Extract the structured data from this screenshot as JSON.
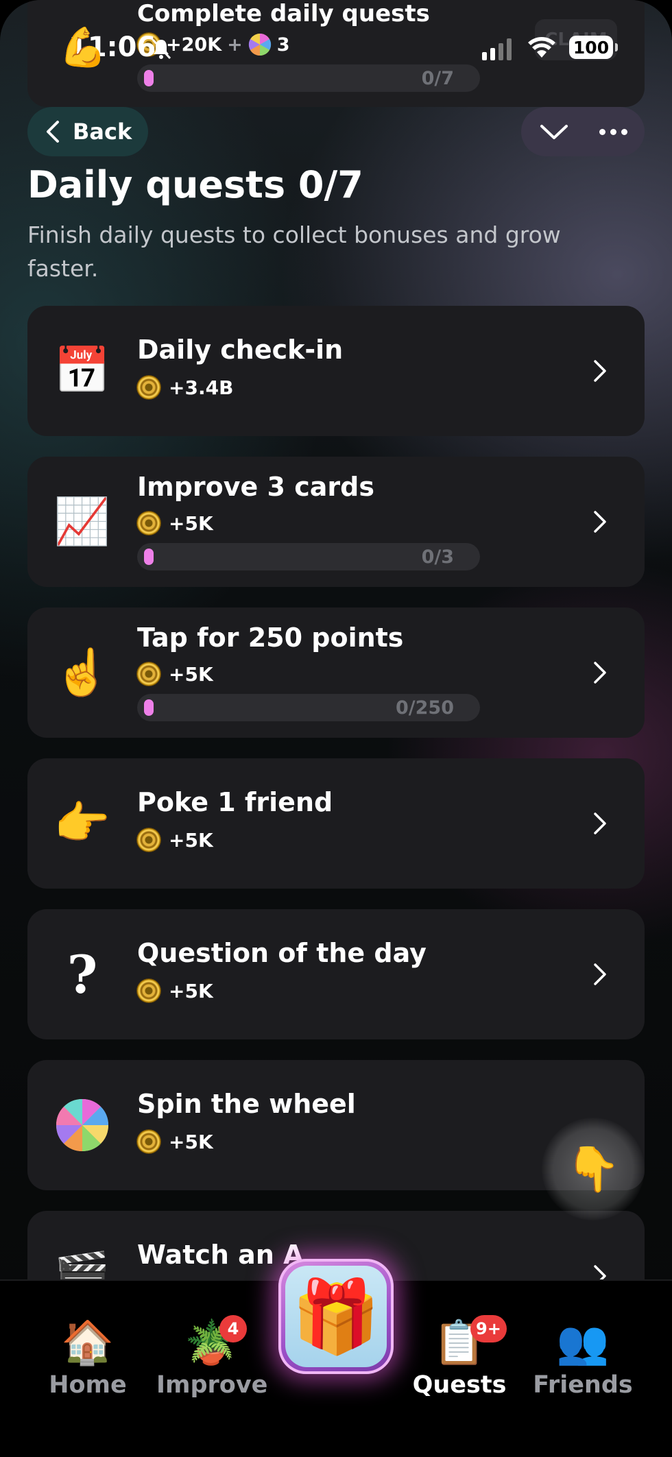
{
  "top_card": {
    "title": "Complete daily quests",
    "reward_coins": "+20K",
    "reward_plus": "+",
    "reward_spins": "3",
    "progress_text": "0/7",
    "progress": 0,
    "claim_label": "CLAIM"
  },
  "status_bar": {
    "time": "11:06",
    "battery": "100"
  },
  "nav": {
    "back_label": "Back"
  },
  "header": {
    "title": "Daily quests 0/7",
    "subtitle": "Finish daily quests to collect bonuses and grow faster."
  },
  "quests": [
    {
      "title": "Daily check-in",
      "reward": "+3.4B",
      "icon": "calendar-icon",
      "glyph": "📅"
    },
    {
      "title": "Improve 3 cards",
      "reward": "+5K",
      "icon": "chart-increasing-icon",
      "glyph": "📈",
      "progress_text": "0/3",
      "progress": 0
    },
    {
      "title": "Tap for 250 points",
      "reward": "+5K",
      "icon": "index-pointing-up-icon",
      "glyph": "☝️",
      "progress_text": "0/250",
      "progress": 0
    },
    {
      "title": "Poke 1 friend",
      "reward": "+5K",
      "icon": "pointing-right-icon",
      "glyph": "👉"
    },
    {
      "title": "Question of the day",
      "reward": "+5K",
      "icon": "question-mark-icon",
      "glyph": "?"
    },
    {
      "title": "Spin the wheel",
      "reward": "+5K",
      "icon": "wheel-icon",
      "glyph": ""
    },
    {
      "title": "Watch an A",
      "reward": "",
      "icon": "clapper-board-icon",
      "glyph": "🎬"
    }
  ],
  "bottom_nav": {
    "tabs": [
      {
        "label": "Home",
        "icon": "house-icon",
        "glyph": "🏠"
      },
      {
        "label": "Improve",
        "icon": "seedling-pot-icon",
        "glyph": "🪴",
        "badge": "4"
      },
      {
        "label": "Quests",
        "icon": "quest-scroll-icon",
        "glyph": "📋",
        "badge": "9+",
        "active": true
      },
      {
        "label": "Friends",
        "icon": "friends-icon",
        "glyph": "👥"
      }
    ],
    "center": {
      "icon": "gift-icon",
      "glyph": "🎁"
    }
  },
  "colors": {
    "progress_fill": "#ee80e8",
    "badge": "#ea3b3b",
    "card": "#1c1c1f",
    "back_button": "#1c3a3c"
  }
}
